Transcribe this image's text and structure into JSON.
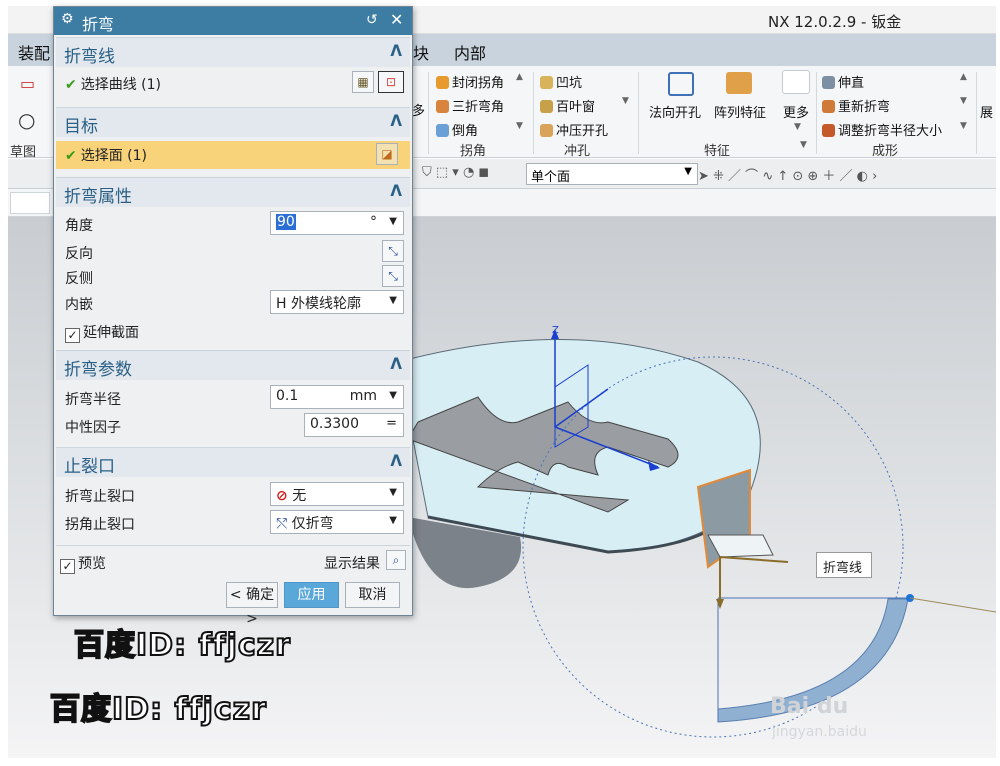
{
  "app": {
    "title": "NX 12.0.2.9 - 钣金"
  },
  "menubar": {
    "items": [
      "装配",
      "块",
      "内部"
    ]
  },
  "ribbon": {
    "left_label": "草图",
    "buttons": {
      "closed_corner": "封闭拐角",
      "three_bend": "三折弯角",
      "chamfer": "倒角",
      "dimple": "凹坑",
      "louver": "百叶窗",
      "drawn_cutout": "冲压开孔",
      "normal_cutout": "法向开孔",
      "pattern_feature": "阵列特征",
      "more": "更多",
      "unbend": "伸直",
      "rebend": "重新折弯",
      "adjust_radius": "调整折弯半径大小",
      "partial": "展",
      "more_left": "多"
    },
    "groups": {
      "corner": "拐角",
      "punch": "冲孔",
      "feature": "特征",
      "forming": "成形"
    }
  },
  "toolbar2": {
    "select_filter": "单个面"
  },
  "dialog": {
    "title": "折弯",
    "sections": {
      "bend_line": {
        "title": "折弯线",
        "select_curve": "选择曲线 (1)"
      },
      "target": {
        "title": "目标",
        "select_face": "选择面 (1)"
      },
      "bend_props": {
        "title": "折弯属性",
        "angle_label": "角度",
        "angle_value": "90",
        "angle_unit": "°",
        "reverse_label": "反向",
        "reverse_side_label": "反侧",
        "inset_label": "内嵌",
        "inset_value": "H 外模线轮廓",
        "extend_section_label": "延伸截面"
      },
      "bend_params": {
        "title": "折弯参数",
        "radius_label": "折弯半径",
        "radius_value": "0.1",
        "radius_unit": "mm",
        "neutral_label": "中性因子",
        "neutral_value": "0.3300",
        "neutral_eq": "="
      },
      "relief": {
        "title": "止裂口",
        "bend_relief_label": "折弯止裂口",
        "bend_relief_value": "无",
        "corner_relief_label": "拐角止裂口",
        "corner_relief_value": "仅折弯"
      }
    },
    "preview_label": "预览",
    "show_result_label": "显示结果",
    "ok": "< 确定 >",
    "apply": "应用",
    "cancel": "取消"
  },
  "viewport": {
    "bend_line_tip": "折弯线",
    "axis_z": "Z"
  },
  "watermarks": {
    "line1": "百度ID: ffjczr",
    "line2": "百度ID: ffjczr",
    "logo": "Bai du",
    "url": "jingyan.baidu"
  }
}
